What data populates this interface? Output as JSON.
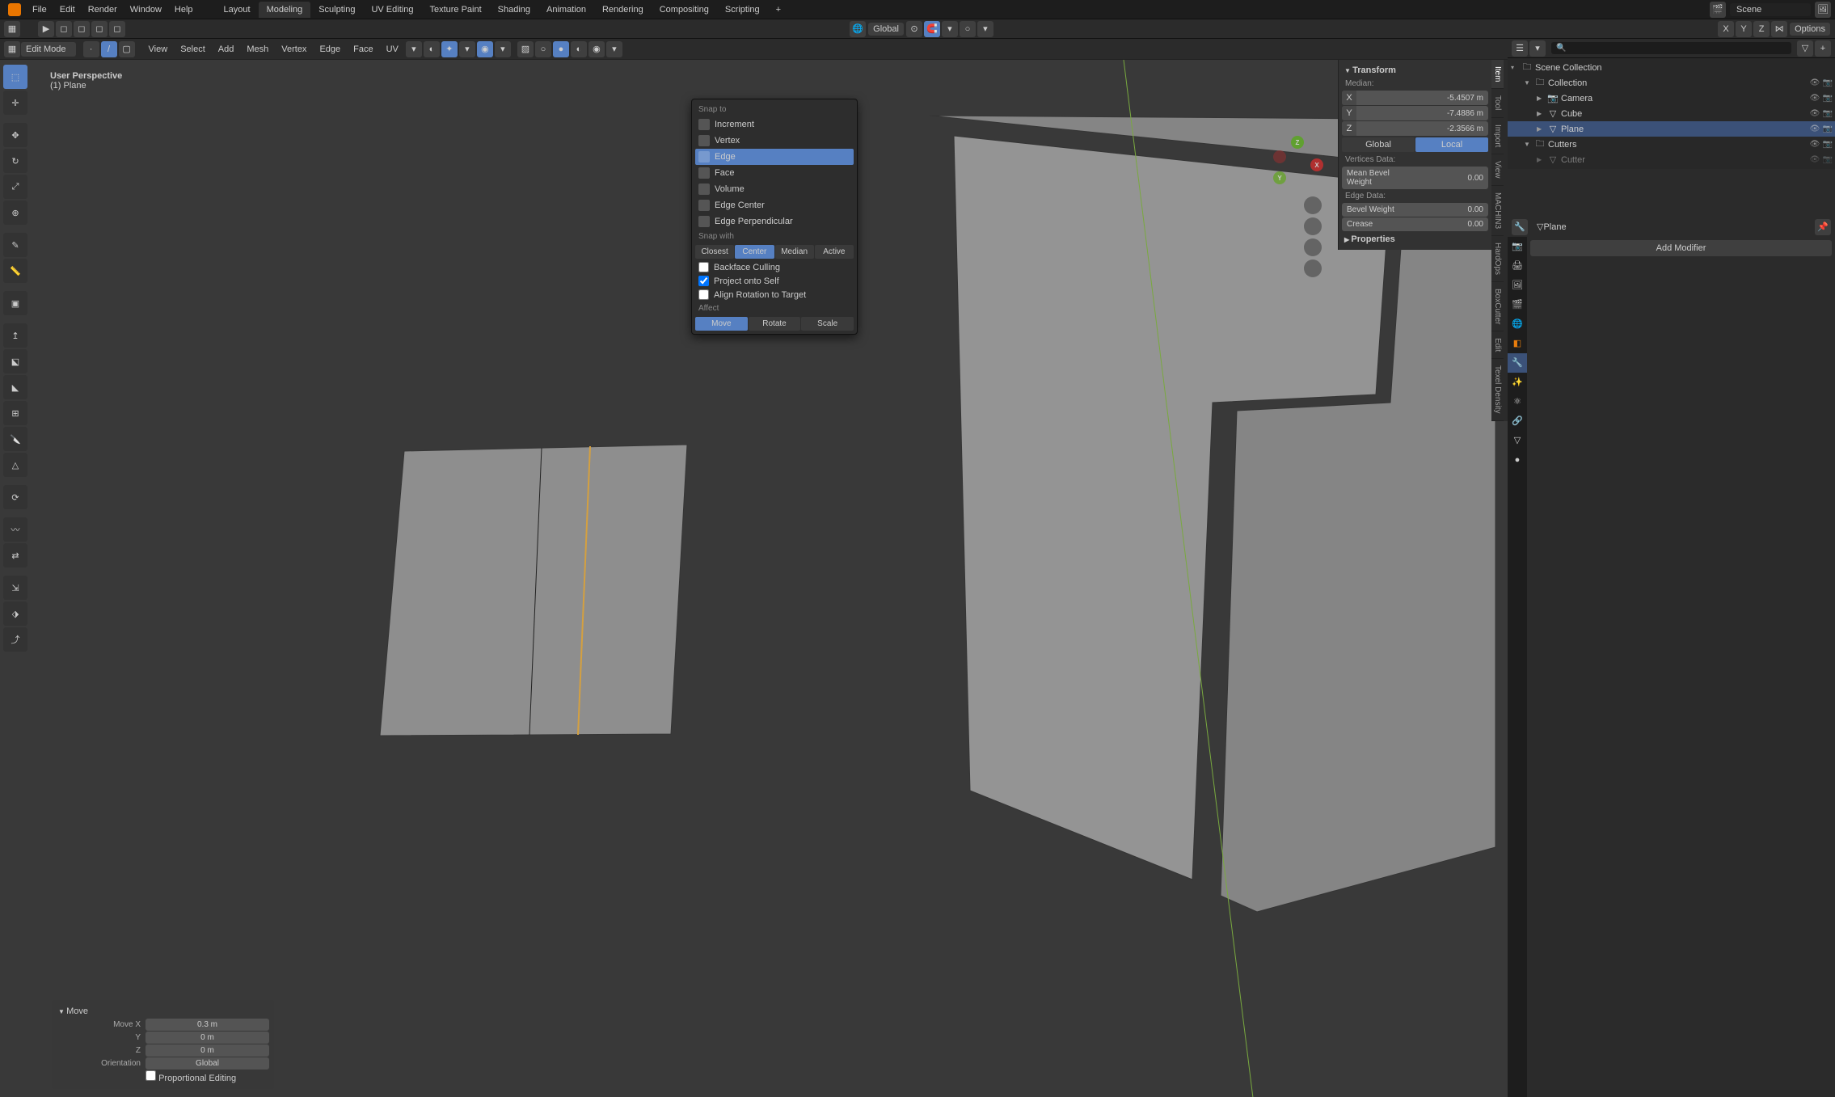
{
  "app": {
    "scene_label": "Scene"
  },
  "menubar": [
    "File",
    "Edit",
    "Render",
    "Window",
    "Help"
  ],
  "workspaces": [
    "Layout",
    "Modeling",
    "Sculpting",
    "UV Editing",
    "Texture Paint",
    "Shading",
    "Animation",
    "Rendering",
    "Compositing",
    "Scripting"
  ],
  "workspace_active": "Modeling",
  "second_bar": {
    "orientation": "Global",
    "options": "Options"
  },
  "viewport": {
    "mode": "Edit Mode",
    "menus": [
      "View",
      "Select",
      "Add",
      "Mesh",
      "Vertex",
      "Edge",
      "Face",
      "UV"
    ],
    "info_perspective": "User Perspective",
    "info_object": "(1) Plane"
  },
  "snap": {
    "title": "Snap to",
    "items": [
      {
        "label": "Increment",
        "active": false
      },
      {
        "label": "Vertex",
        "active": false
      },
      {
        "label": "Edge",
        "active": true
      },
      {
        "label": "Face",
        "active": false
      },
      {
        "label": "Volume",
        "active": false
      },
      {
        "label": "Edge Center",
        "active": false
      },
      {
        "label": "Edge Perpendicular",
        "active": false
      }
    ],
    "snap_with_label": "Snap with",
    "snap_with": [
      "Closest",
      "Center",
      "Median",
      "Active"
    ],
    "snap_with_active": "Center",
    "checks": [
      {
        "label": "Backface Culling",
        "checked": false
      },
      {
        "label": "Project onto Self",
        "checked": true
      },
      {
        "label": "Align Rotation to Target",
        "checked": false
      }
    ],
    "affect_label": "Affect",
    "affect": [
      "Move",
      "Rotate",
      "Scale"
    ],
    "affect_active": "Move"
  },
  "npanel": {
    "transform_label": "Transform",
    "median_label": "Median:",
    "median": {
      "X": "-5.4507 m",
      "Y": "-7.4886 m",
      "Z": "-2.3566 m"
    },
    "space": [
      "Global",
      "Local"
    ],
    "space_active": "Local",
    "vertices_data_label": "Vertices Data:",
    "mean_bevel_weight_label": "Mean Bevel Weight",
    "mean_bevel_weight": "0.00",
    "edge_data_label": "Edge Data:",
    "bevel_weight_label": "Bevel Weight",
    "bevel_weight": "0.00",
    "crease_label": "Crease",
    "crease": "0.00",
    "properties_label": "Properties",
    "tabs": [
      "Item",
      "Tool",
      "Import",
      "View",
      "MACHIN3",
      "HardOps",
      "BoxCutter",
      "Edit",
      "Texel Density"
    ]
  },
  "operator": {
    "title": "Move",
    "move_x_label": "Move X",
    "move_x": "0.3 m",
    "y_label": "Y",
    "y": "0 m",
    "z_label": "Z",
    "z": "0 m",
    "orientation_label": "Orientation",
    "orientation": "Global",
    "proportional_label": "Proportional Editing"
  },
  "outliner": {
    "root": "Scene Collection",
    "items": [
      {
        "label": "Collection",
        "depth": 1,
        "type": "collection",
        "disc": "▼"
      },
      {
        "label": "Camera",
        "depth": 2,
        "type": "camera",
        "disc": "▶"
      },
      {
        "label": "Cube",
        "depth": 2,
        "type": "mesh",
        "disc": "▶"
      },
      {
        "label": "Plane",
        "depth": 2,
        "type": "mesh",
        "disc": "▶",
        "active": true
      },
      {
        "label": "Cutters",
        "depth": 1,
        "type": "collection",
        "disc": "▼"
      },
      {
        "label": "Cutter",
        "depth": 2,
        "type": "mesh",
        "disc": "▶",
        "dim": true
      }
    ]
  },
  "properties": {
    "context_object": "Plane",
    "add_modifier": "Add Modifier"
  }
}
